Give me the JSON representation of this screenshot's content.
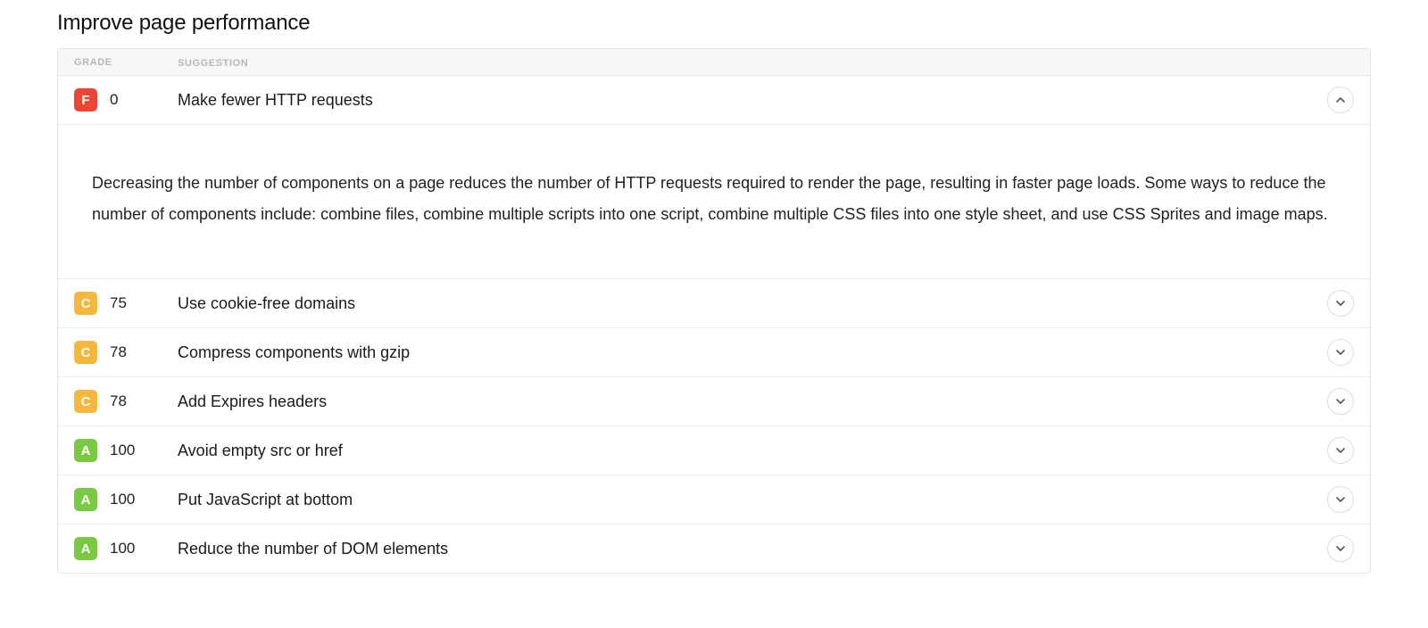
{
  "title": "Improve page performance",
  "columns": {
    "grade": "GRADE",
    "suggestion": "SUGGESTION"
  },
  "rows": [
    {
      "grade": "F",
      "score": "0",
      "suggestion": "Make fewer HTTP requests",
      "expanded": true,
      "detail": "Decreasing the number of components on a page reduces the number of HTTP requests required to render the page, resulting in faster page loads. Some ways to reduce the number of components include: combine files, combine multiple scripts into one script, combine multiple CSS files into one style sheet, and use CSS Sprites and image maps."
    },
    {
      "grade": "C",
      "score": "75",
      "suggestion": "Use cookie-free domains",
      "expanded": false
    },
    {
      "grade": "C",
      "score": "78",
      "suggestion": "Compress components with gzip",
      "expanded": false
    },
    {
      "grade": "C",
      "score": "78",
      "suggestion": "Add Expires headers",
      "expanded": false
    },
    {
      "grade": "A",
      "score": "100",
      "suggestion": "Avoid empty src or href",
      "expanded": false
    },
    {
      "grade": "A",
      "score": "100",
      "suggestion": "Put JavaScript at bottom",
      "expanded": false
    },
    {
      "grade": "A",
      "score": "100",
      "suggestion": "Reduce the number of DOM elements",
      "expanded": false
    }
  ]
}
